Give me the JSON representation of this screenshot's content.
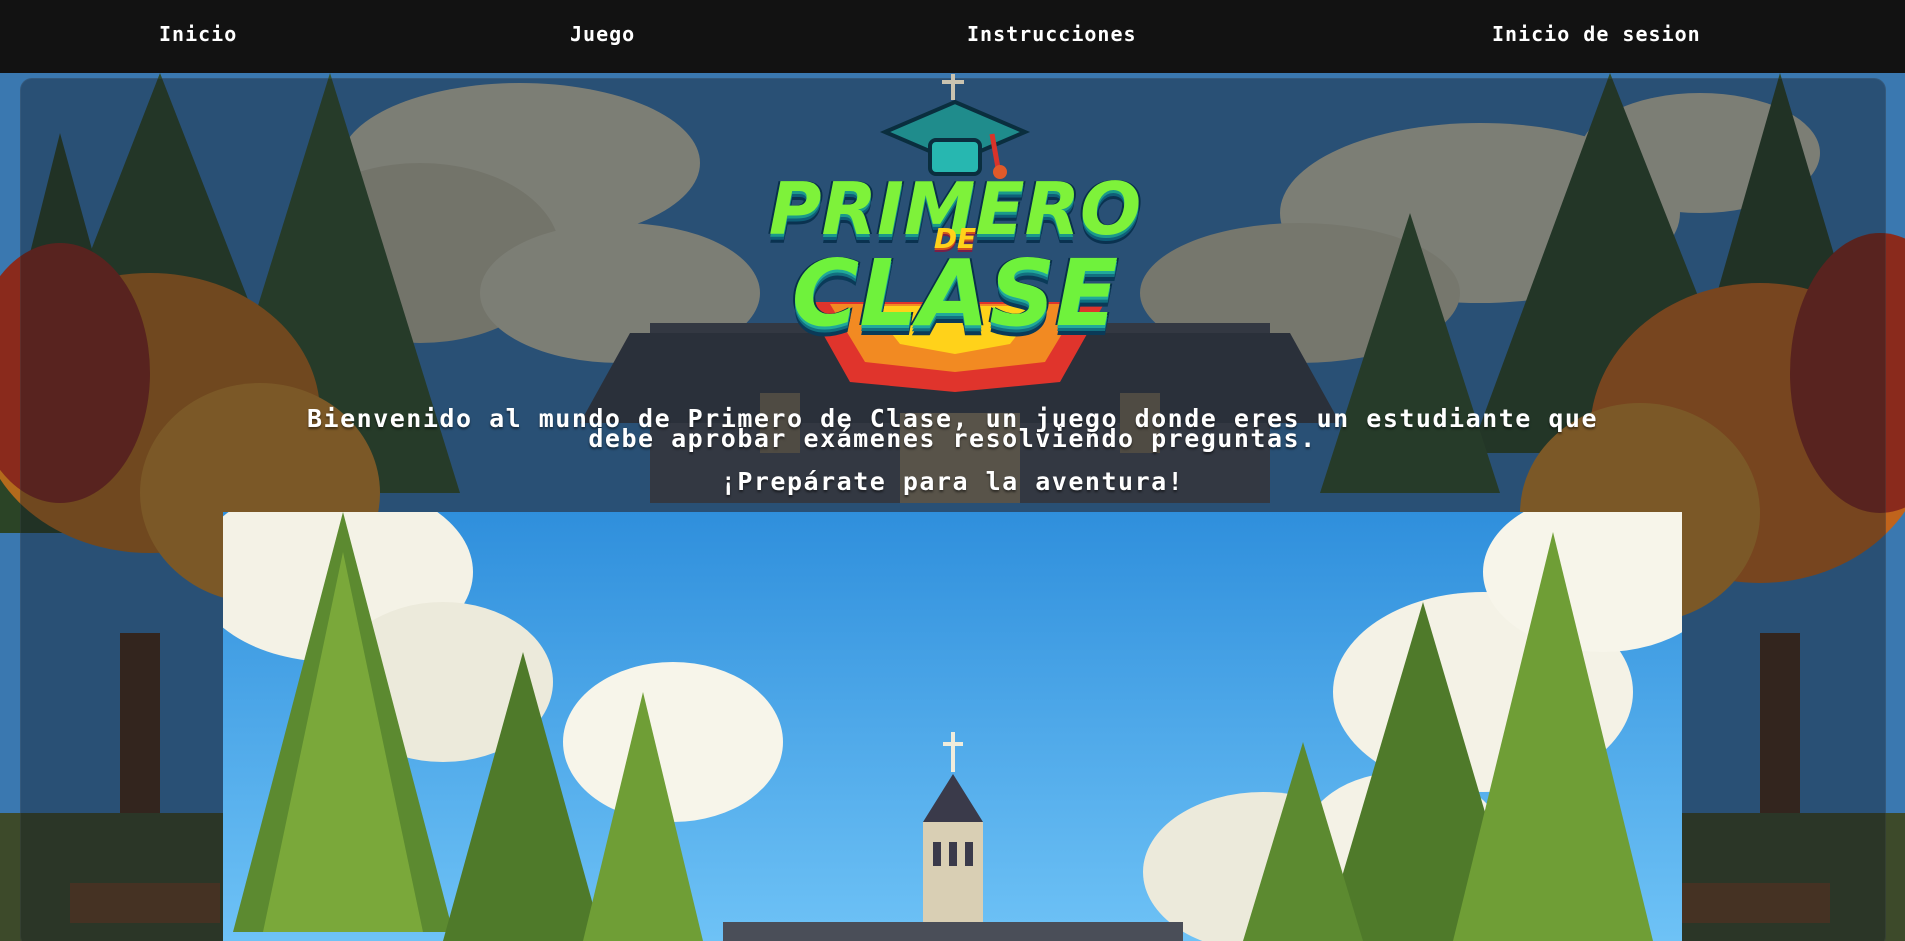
{
  "nav": {
    "items": [
      {
        "label": "Inicio"
      },
      {
        "label": "Juego"
      },
      {
        "label": "Instrucciones"
      },
      {
        "label": "Inicio de sesion"
      }
    ]
  },
  "logo": {
    "line1": "PRIMERO",
    "line2": "DE",
    "line3": "CLASE"
  },
  "hero": {
    "welcome": "Bienvenido al mundo de Primero de Clase, un juego donde eres un estudiante que debe aprobar exámenes resolviendo preguntas.",
    "tagline": "¡Prepárate para la aventura!"
  },
  "colors": {
    "nav_bg": "#121212",
    "sky": "#5ab4f0",
    "logo_green": "#7ef23a",
    "logo_yellow": "#ffd21a"
  }
}
